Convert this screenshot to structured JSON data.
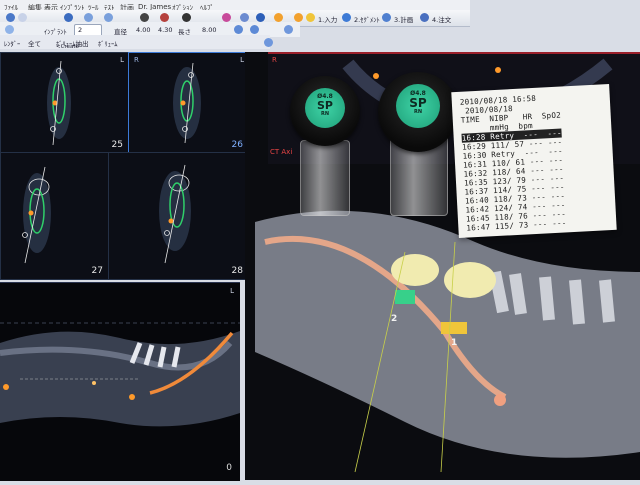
{
  "menubar": {
    "items": [
      "ﾌｧｲﾙ",
      "編集",
      "表示",
      "ｲﾝﾌﾟﾗﾝﾄ",
      "ﾂｰﾙ",
      "ﾃｽﾄ",
      "計画",
      "Dr. James",
      "ｵﾌﾟｼｮﾝ",
      "ﾍﾙﾌﾟ"
    ]
  },
  "toolbar": {
    "step1": "1.入力",
    "step2": "2.ｾｸﾞﾒﾝﾄ",
    "step3": "3.計画",
    "step4": "4.注文",
    "implant_label": "ｲﾝﾌﾟﾗﾝﾄ",
    "implant_value": "2",
    "diameter_label": "直径",
    "diameter_value": "4.00",
    "length_value": "4.30",
    "length_label": "長さ",
    "length2": "8.00",
    "edit_label": "ﾎﾞﾘｭｰﾑ",
    "all_label": "全て",
    "volume_label": "ﾎﾞﾘｭｰﾑ抽出",
    "create_label": "<Create",
    "render_label": "ﾚﾝﾀﾞｰ"
  },
  "viewports": [
    {
      "number": "25",
      "corner_right": "L",
      "corner_left": ""
    },
    {
      "number": "26",
      "corner_right": "L",
      "corner_left": "R"
    },
    {
      "number": "27",
      "corner_right": "",
      "corner_left": ""
    },
    {
      "number": "28",
      "corner_right": "",
      "corner_left": ""
    }
  ],
  "panorama": {
    "number": "0",
    "corner": "L"
  },
  "ct_axial": {
    "label": "CT Axi",
    "corner": "R"
  },
  "vials": [
    {
      "size": "Ø4.8",
      "code": "SP",
      "sub": "RN"
    },
    {
      "size": "Ø4.8",
      "code": "SP",
      "sub": "RN"
    }
  ],
  "implant_markers": [
    "2",
    "1"
  ],
  "printout": {
    "lines": [
      "2010/08/18 16:58",
      " 2010/08/18",
      "TIME  NIBP   HR  SpO2",
      "      mmHg  bpm",
      "16:28 Retry  ---  ---",
      "16:29 111/ 57 --- ---",
      "16:30 Retry  ---  ---",
      "16:31 110/ 61 --- ---",
      "16:32 118/ 64 --- ---",
      "16:35 123/ 79 --- ---",
      "16:37 114/ 75 --- ---",
      "16:40 118/ 73 --- ---",
      "16:42 124/ 74 --- ---",
      "16:45 118/ 76 --- ---",
      "16:47 115/ 73 --- ---"
    ]
  }
}
